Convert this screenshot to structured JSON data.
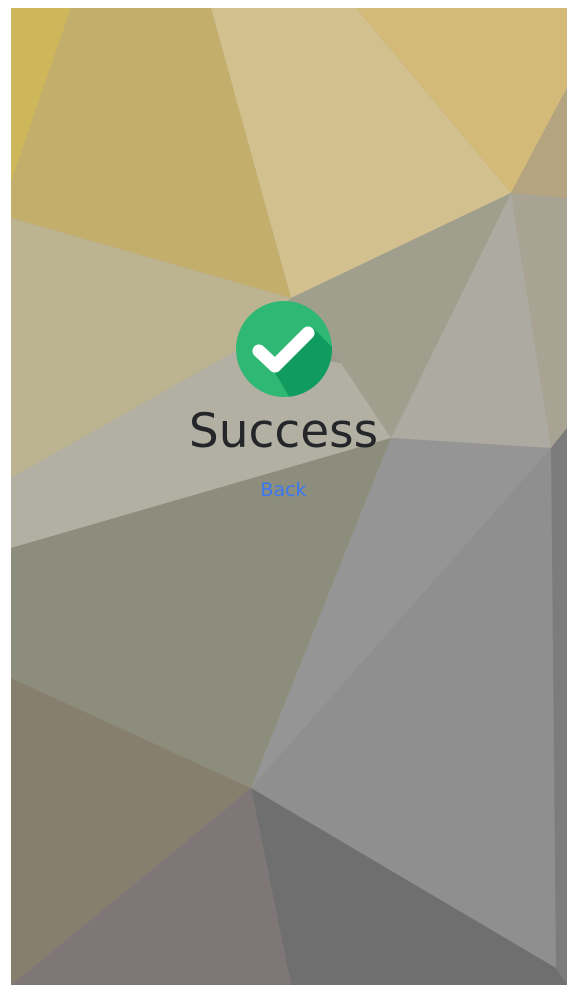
{
  "page": {
    "title": "Success",
    "back_label": "Back"
  },
  "icons": {
    "status": "check-circle-icon"
  },
  "colors": {
    "success_green": "#2fb873",
    "success_green_dark": "#0f9c5e",
    "link_blue": "#3a78f2",
    "title_text": "#24262a"
  }
}
